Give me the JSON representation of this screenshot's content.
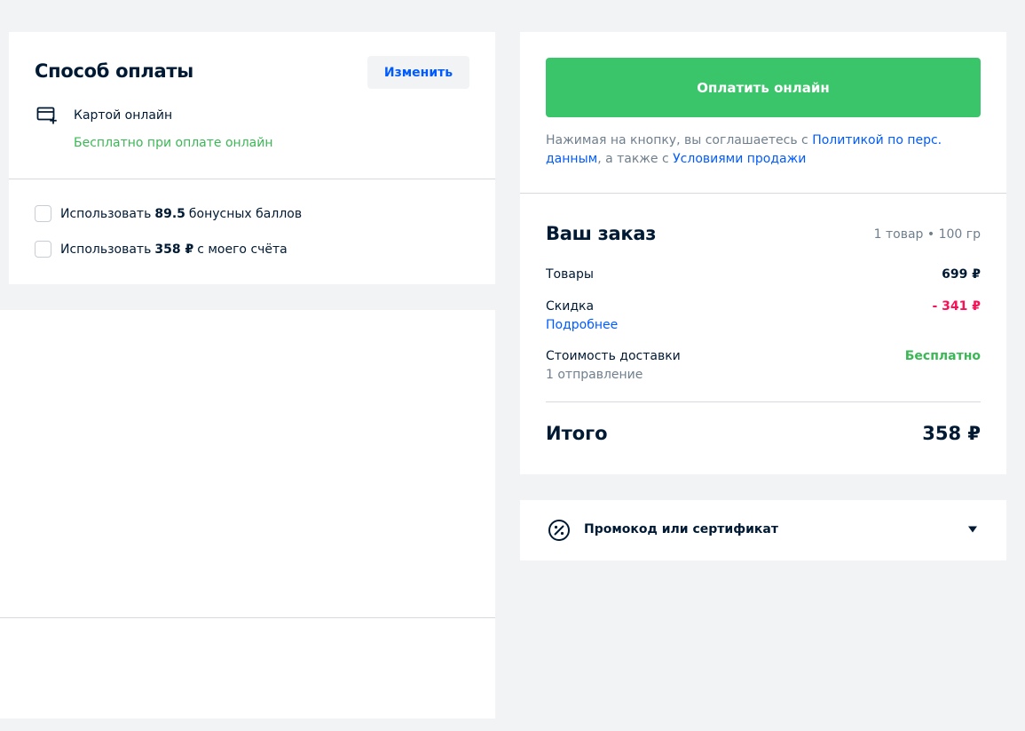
{
  "payment": {
    "title": "Способ оплаты",
    "change_label": "Изменить",
    "method": "Картой онлайн",
    "method_icon": "card-add-icon",
    "free_note": "Бесплатно при оплате онлайн",
    "bonus_points": {
      "prefix": "Использовать",
      "amount": "89.5",
      "suffix": "бонусных баллов"
    },
    "account": {
      "prefix": "Использовать",
      "amount": "358 ₽",
      "suffix": "с моего счёта"
    }
  },
  "summary": {
    "pay_button": "Оплатить онлайн",
    "agreement": {
      "text1": "Нажимая на кнопку, вы соглашаетесь с ",
      "link1": "Политикой по перс. данным",
      "text2": ", а также с ",
      "link2": "Условиями продажи"
    },
    "order_title": "Ваш заказ",
    "order_meta": "1 товар • 100 гр",
    "goods_label": "Товары",
    "goods_value": "699 ₽",
    "discount_label": "Скидка",
    "discount_link": "Подробнее",
    "discount_value": "- 341 ₽",
    "delivery_label": "Стоимость доставки",
    "delivery_sub": "1 отправление",
    "delivery_value": "Бесплатно",
    "total_label": "Итого",
    "total_value": "358 ₽"
  },
  "promo": {
    "label": "Промокод или сертификат",
    "icon": "discount-percent-icon",
    "chevron": "chevron-down-icon"
  },
  "colors": {
    "accent": "#005bff",
    "success": "#3bc56b",
    "discount": "#f91155",
    "text": "#001a34",
    "muted": "#707f8d",
    "background": "#f2f3f5"
  }
}
